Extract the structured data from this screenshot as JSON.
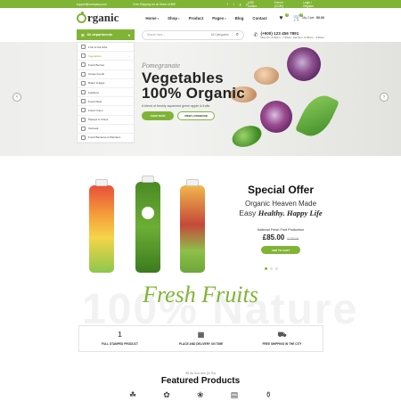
{
  "topbar": {
    "email": "support@company.com",
    "shipping": "Free Shipping for all Order of $99",
    "social": [
      "f",
      "t",
      "g",
      "p"
    ],
    "currency": "USD Dollars",
    "language": "French (CI/JN)",
    "login": "Login / Register"
  },
  "header": {
    "logo": "rganic",
    "nav": [
      "Home",
      "Shop",
      "Product",
      "Pages",
      "Blog",
      "Contact"
    ],
    "wishlist_count": "0",
    "cart_count": "0",
    "cart_label": "My Cart:",
    "cart_total": "$0.00"
  },
  "searchbar": {
    "departments_label": "All departments",
    "placeholder": "Search here...",
    "category": "All Categories",
    "phone": "(+900) 123 456 7891",
    "hours": "Mon-Fri: 8:30am - 7:30pm; Sat-Sun: 9:30am - 4:30pm"
  },
  "departments": [
    {
      "label": "Fruit & Nut Gifts"
    },
    {
      "label": "Vegetables"
    },
    {
      "label": "Fresh Berries"
    },
    {
      "label": "Ocean Foods"
    },
    {
      "label": "Butter & Eggs"
    },
    {
      "label": "Fastfood"
    },
    {
      "label": "Fresh Meat"
    },
    {
      "label": "Fresh Onion"
    },
    {
      "label": "Papaya & Crisps"
    },
    {
      "label": "Oatmeal"
    },
    {
      "label": "Fresh Bananas & Plantains"
    }
  ],
  "hero": {
    "pretitle": "Pomegranate",
    "title1": "Vegetables",
    "title2": "100% Organic",
    "subtitle": "A blend of freshly squeezed green apple & fruits",
    "shop_btn": "SHOP NOW",
    "look_btn": "VIEW LOOKBOOK"
  },
  "offer": {
    "title": "Special Offer",
    "line1": "Organic Heaven Made",
    "line2_pre": "Easy ",
    "line2_em": "Healthy. Happy Life",
    "product": "National Fresh Fruit Production",
    "price": "£85.00",
    "old_price": "£125.00",
    "add_btn": "ADD TO CART"
  },
  "fresh": {
    "bg_text": "100% Nature",
    "title": "Fresh Fruits"
  },
  "features": [
    {
      "label": "FULL STAMPED PRODUCT",
      "icon": "1"
    },
    {
      "label": "PLACE AND DELIVERY ON TIME",
      "icon": "▦"
    },
    {
      "label": "FREE SHIPPING IN THE CITY",
      "icon": "⛟"
    }
  ],
  "featured": {
    "subtitle": "All the best item for You",
    "title": "Featured Products",
    "icons": [
      "☘",
      "✿",
      "❀",
      "▤",
      "⚱"
    ]
  },
  "colors": {
    "accent": "#80b435"
  }
}
